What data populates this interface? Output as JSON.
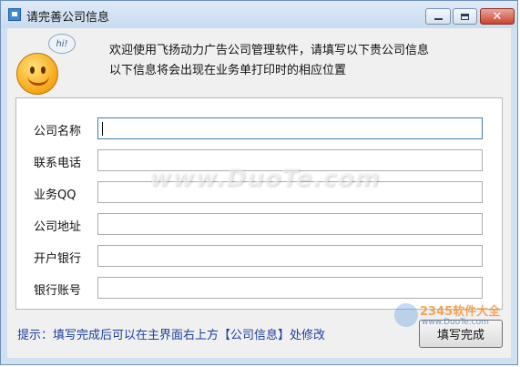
{
  "window": {
    "title": "请完善公司信息",
    "minimize_icon": "minimize-icon",
    "maximize_icon": "maximize-icon",
    "close_icon": "close-icon",
    "close_glyph": "✕"
  },
  "header": {
    "bubble_text": "hi!",
    "welcome_line1": "欢迎使用飞扬动力广告公司管理软件，请填写以下贵公司信息",
    "welcome_line2": "以下信息将会出现在业务单打印时的相应位置"
  },
  "form": {
    "fields": [
      {
        "label": "公司名称",
        "value": ""
      },
      {
        "label": "联系电话",
        "value": ""
      },
      {
        "label": "业务QQ",
        "value": ""
      },
      {
        "label": "公司地址",
        "value": ""
      },
      {
        "label": "开户银行",
        "value": ""
      },
      {
        "label": "银行账号",
        "value": ""
      }
    ]
  },
  "footer": {
    "hint": "提示：填写完成后可以在主界面右上方【公司信息】处修改",
    "submit_label": "填写完成"
  },
  "watermarks": {
    "main": "www.DuoTe.com",
    "brand": "2345软件大全",
    "site": "www.DuoTe.com"
  },
  "colors": {
    "hint_text": "#1b3f9c",
    "close_button": "#c9452f",
    "titlebar": "#c8dbf0"
  }
}
